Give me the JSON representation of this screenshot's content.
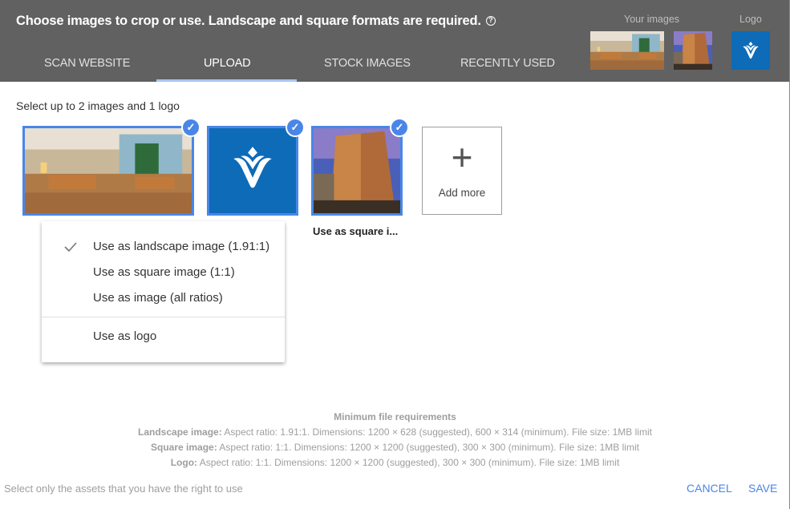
{
  "header": {
    "title": "Choose images to crop or use. Landscape and square formats are required.",
    "help_icon": "question-circle-icon",
    "tabs": [
      {
        "label": "SCAN WEBSITE",
        "active": false
      },
      {
        "label": "UPLOAD",
        "active": true
      },
      {
        "label": "STOCK IMAGES",
        "active": false
      },
      {
        "label": "RECENTLY USED",
        "active": false
      }
    ],
    "your_images_label": "Your images",
    "logo_label": "Logo"
  },
  "selection": {
    "instruction": "Select up to 2 images and 1 logo",
    "items": [
      {
        "type": "hotel-lobby-photo",
        "selected": true
      },
      {
        "type": "brand-logo",
        "selected": true
      },
      {
        "type": "hotel-building-photo",
        "selected": true,
        "caption": "Use as square i..."
      }
    ],
    "add_more": {
      "icon": "plus-icon",
      "label": "Add more"
    }
  },
  "menu": {
    "items": [
      {
        "label": "Use as landscape image (1.91:1)",
        "checked": true
      },
      {
        "label": "Use as square image (1:1)",
        "checked": false
      },
      {
        "label": "Use as image (all ratios)",
        "checked": false
      },
      {
        "label": "Use as logo",
        "checked": false
      }
    ]
  },
  "requirements": {
    "title": "Minimum file requirements",
    "rows": [
      {
        "name": "Landscape image:",
        "text": "Aspect ratio: 1.91:1. Dimensions: 1200 × 628 (suggested), 600 × 314 (minimum). File size: 1MB limit"
      },
      {
        "name": "Square image:",
        "text": "Aspect ratio: 1:1. Dimensions: 1200 × 1200 (suggested), 300 × 300 (minimum). File size: 1MB limit"
      },
      {
        "name": "Logo:",
        "text": "Aspect ratio: 1:1. Dimensions: 1200 × 1200 (suggested), 300 × 300 (minimum). File size: 1MB limit"
      }
    ]
  },
  "footer": {
    "note": "Select only the assets that you have the right to use",
    "cancel": "CANCEL",
    "save": "SAVE"
  },
  "colors": {
    "header_bg": "#616161",
    "accent": "#4a86e8",
    "logo_blue": "#0e6bb8"
  }
}
